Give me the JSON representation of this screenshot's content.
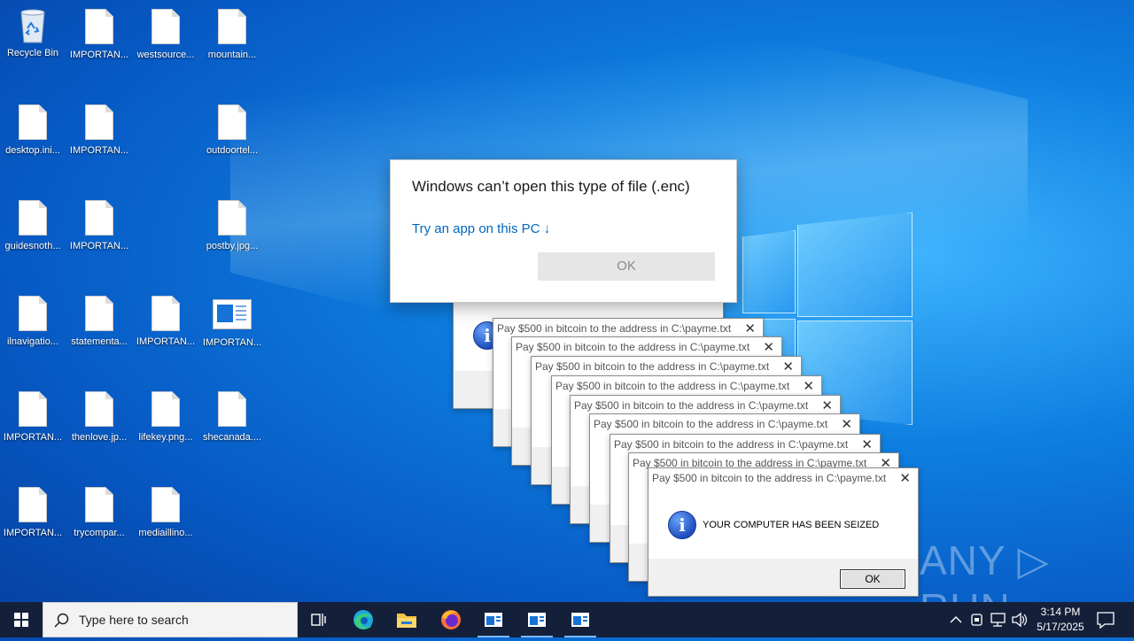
{
  "desktop": {
    "icons": [
      {
        "label": "Recycle Bin",
        "icon": "recycle-bin-icon"
      },
      {
        "label": "IMPORTAN...",
        "icon": "file-icon"
      },
      {
        "label": "westsource...",
        "icon": "file-icon"
      },
      {
        "label": "mountain...",
        "icon": "file-icon"
      },
      {
        "label": "desktop.ini...",
        "icon": "file-icon"
      },
      {
        "label": "IMPORTAN...",
        "icon": "file-icon"
      },
      {
        "label": "outdoortel...",
        "icon": "file-icon"
      },
      {
        "label": "guidesnoth...",
        "icon": "file-icon"
      },
      {
        "label": "IMPORTAN...",
        "icon": "file-icon"
      },
      {
        "label": "postby.jpg...",
        "icon": "file-icon"
      },
      {
        "label": "ilnavigatio...",
        "icon": "file-icon"
      },
      {
        "label": "statementa...",
        "icon": "file-icon"
      },
      {
        "label": "IMPORTAN...",
        "icon": "file-icon"
      },
      {
        "label": "IMPORTAN...",
        "icon": "document-image-icon"
      },
      {
        "label": "IMPORTAN...",
        "icon": "file-icon"
      },
      {
        "label": "thenlove.jp...",
        "icon": "file-icon"
      },
      {
        "label": "lifekey.png...",
        "icon": "file-icon"
      },
      {
        "label": "shecanada....",
        "icon": "file-icon"
      },
      {
        "label": "IMPORTAN...",
        "icon": "file-icon"
      },
      {
        "label": "trycompar...",
        "icon": "file-icon"
      },
      {
        "label": "mediaillino...",
        "icon": "file-icon"
      }
    ]
  },
  "open_dialog": {
    "title": "Windows can’t open this type of file (.enc)",
    "link": "Try an app on this PC ↓",
    "ok": "OK"
  },
  "ransom_boxes": {
    "title": "Pay $500 in bitcoin to the address in C:\\payme.txt",
    "close": "✕",
    "message": "YOUR COMPUTER HAS BEEN SEIZED",
    "ok": "OK",
    "count": 9
  },
  "watermark": "ANY ▷ RUN",
  "taskbar": {
    "search_placeholder": "Type here to search",
    "apps": [
      "task-view",
      "edge",
      "file-explorer",
      "firefox",
      "app-window",
      "app-window",
      "app-window"
    ],
    "clock_time": "3:14 PM",
    "clock_date": "5/17/2025"
  },
  "colors": {
    "accent": "#0067c0",
    "taskbar": "#14203a"
  }
}
